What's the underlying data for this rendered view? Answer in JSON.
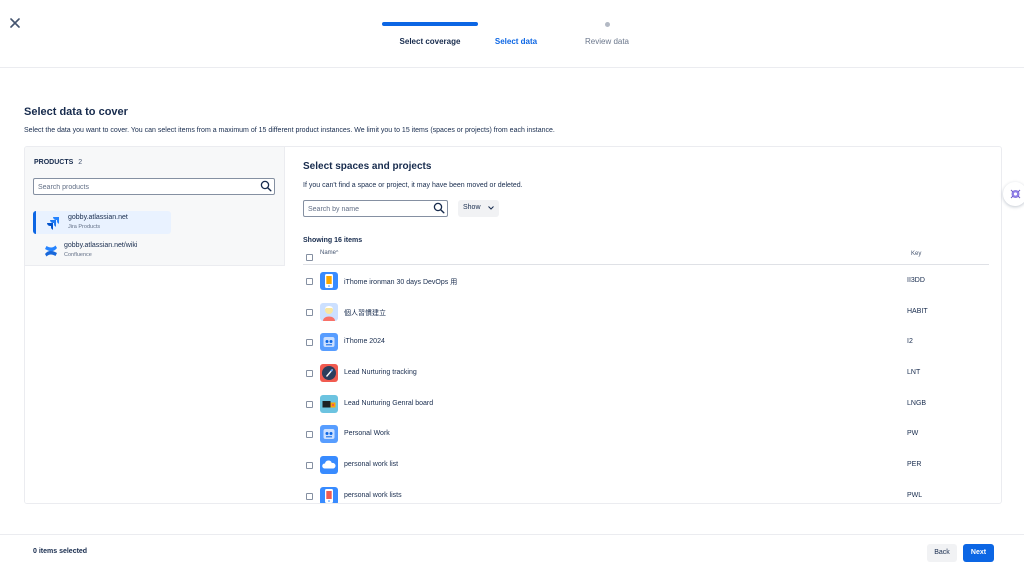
{
  "header": {
    "close_icon": "close-icon",
    "steps": [
      {
        "label": "Select coverage",
        "state": "complete"
      },
      {
        "label": "Select data",
        "state": "current"
      },
      {
        "label": "Review data",
        "state": "upcoming"
      }
    ]
  },
  "page": {
    "title": "Select data to cover",
    "subtitle": "Select the data you want to cover. You can select items from a maximum of 15 different product instances. We limit you to 15 items (spaces or projects) from each instance."
  },
  "products": {
    "heading": "PRODUCTS",
    "count": "2",
    "search_placeholder": "Search products",
    "items": [
      {
        "name": "gobby.atlassian.net",
        "type": "Jira Products",
        "icon": "jira-icon",
        "selected": true
      },
      {
        "name": "gobby.atlassian.net/wiki",
        "type": "Confluence",
        "icon": "confluence-icon",
        "selected": false
      }
    ]
  },
  "spaces": {
    "title": "Select spaces and projects",
    "subtitle": "If you can't find a space or project, it may have been moved or deleted.",
    "search_placeholder": "Search by name",
    "show_label": "Show",
    "showing_text": "Showing 16 items",
    "columns": {
      "name": "Name",
      "sort_indicator": "^",
      "key": "Key"
    },
    "rows": [
      {
        "name": "iThome ironman 30 days DevOps 用",
        "key": "II3DD",
        "icon": "phone-avatar-icon"
      },
      {
        "name": "個人習慣建立",
        "key": "HABIT",
        "icon": "person-avatar-icon"
      },
      {
        "name": "iThome 2024",
        "key": "I2",
        "icon": "robot-avatar-icon"
      },
      {
        "name": "Lead Nurturing tracking",
        "key": "LNT",
        "icon": "rocket-avatar-icon"
      },
      {
        "name": "Lead Nurturing Genral board",
        "key": "LNGB",
        "icon": "folder-avatar-icon"
      },
      {
        "name": "Personal Work",
        "key": "PW",
        "icon": "robot-avatar-icon"
      },
      {
        "name": "personal work list",
        "key": "PER",
        "icon": "cloud-avatar-icon"
      },
      {
        "name": "personal work lists",
        "key": "PWL",
        "icon": "phone-avatar-icon"
      }
    ]
  },
  "footer": {
    "selected_text": "0 items selected",
    "back_label": "Back",
    "next_label": "Next"
  },
  "colors": {
    "primary": "#0c66e4",
    "text": "#172b4d",
    "selected_bg": "#e9f2ff"
  }
}
